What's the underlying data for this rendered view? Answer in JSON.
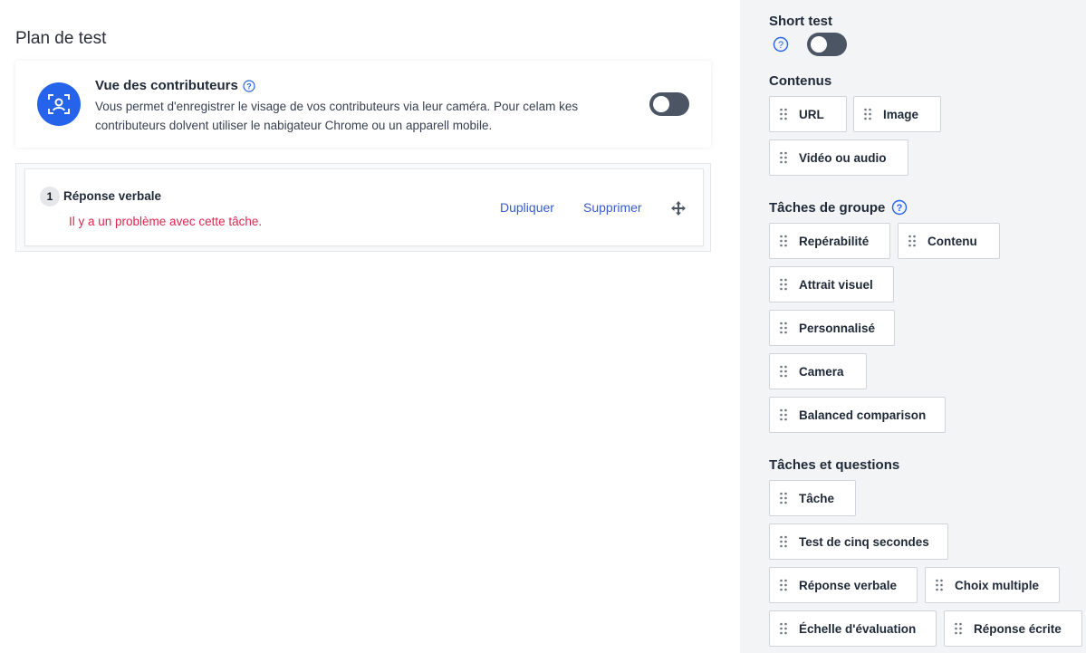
{
  "main": {
    "title": "Plan de test",
    "camera_card": {
      "title": "Vue des contributeurs",
      "description": "Vous permet d'enregistrer le visage de vos contributeurs via leur caméra. Pour celam kes contributeurs dolvent utiliser le nabigateur Chrome ou un apparell mobile.",
      "toggle_on": false
    },
    "task": {
      "number": "1",
      "title": "Réponse verbale",
      "error": "Il y a un problème avec cette tâche.",
      "duplicate_label": "Dupliquer",
      "delete_label": "Supprimer"
    }
  },
  "sidebar": {
    "short_test": {
      "title": "Short test",
      "toggle_on": false
    },
    "contenus": {
      "title": "Contenus",
      "items": [
        "URL",
        "Image",
        "Vidéo ou audio"
      ]
    },
    "group_tasks": {
      "title": "Tâches de groupe",
      "items": [
        "Repérabilité",
        "Contenu",
        "Attrait visuel",
        "Personnalisé",
        "Camera",
        "Balanced comparison"
      ]
    },
    "tasks_questions": {
      "title": "Tâches et questions",
      "items": [
        "Tâche",
        "Test de cinq secondes",
        "Réponse verbale",
        "Choix multiple",
        "Échelle d'évaluation",
        "Réponse écrite"
      ]
    }
  },
  "colors": {
    "accent": "#2563eb",
    "error": "#dc2650",
    "link": "#3a5bcc",
    "toggle_off": "#4b5563"
  }
}
